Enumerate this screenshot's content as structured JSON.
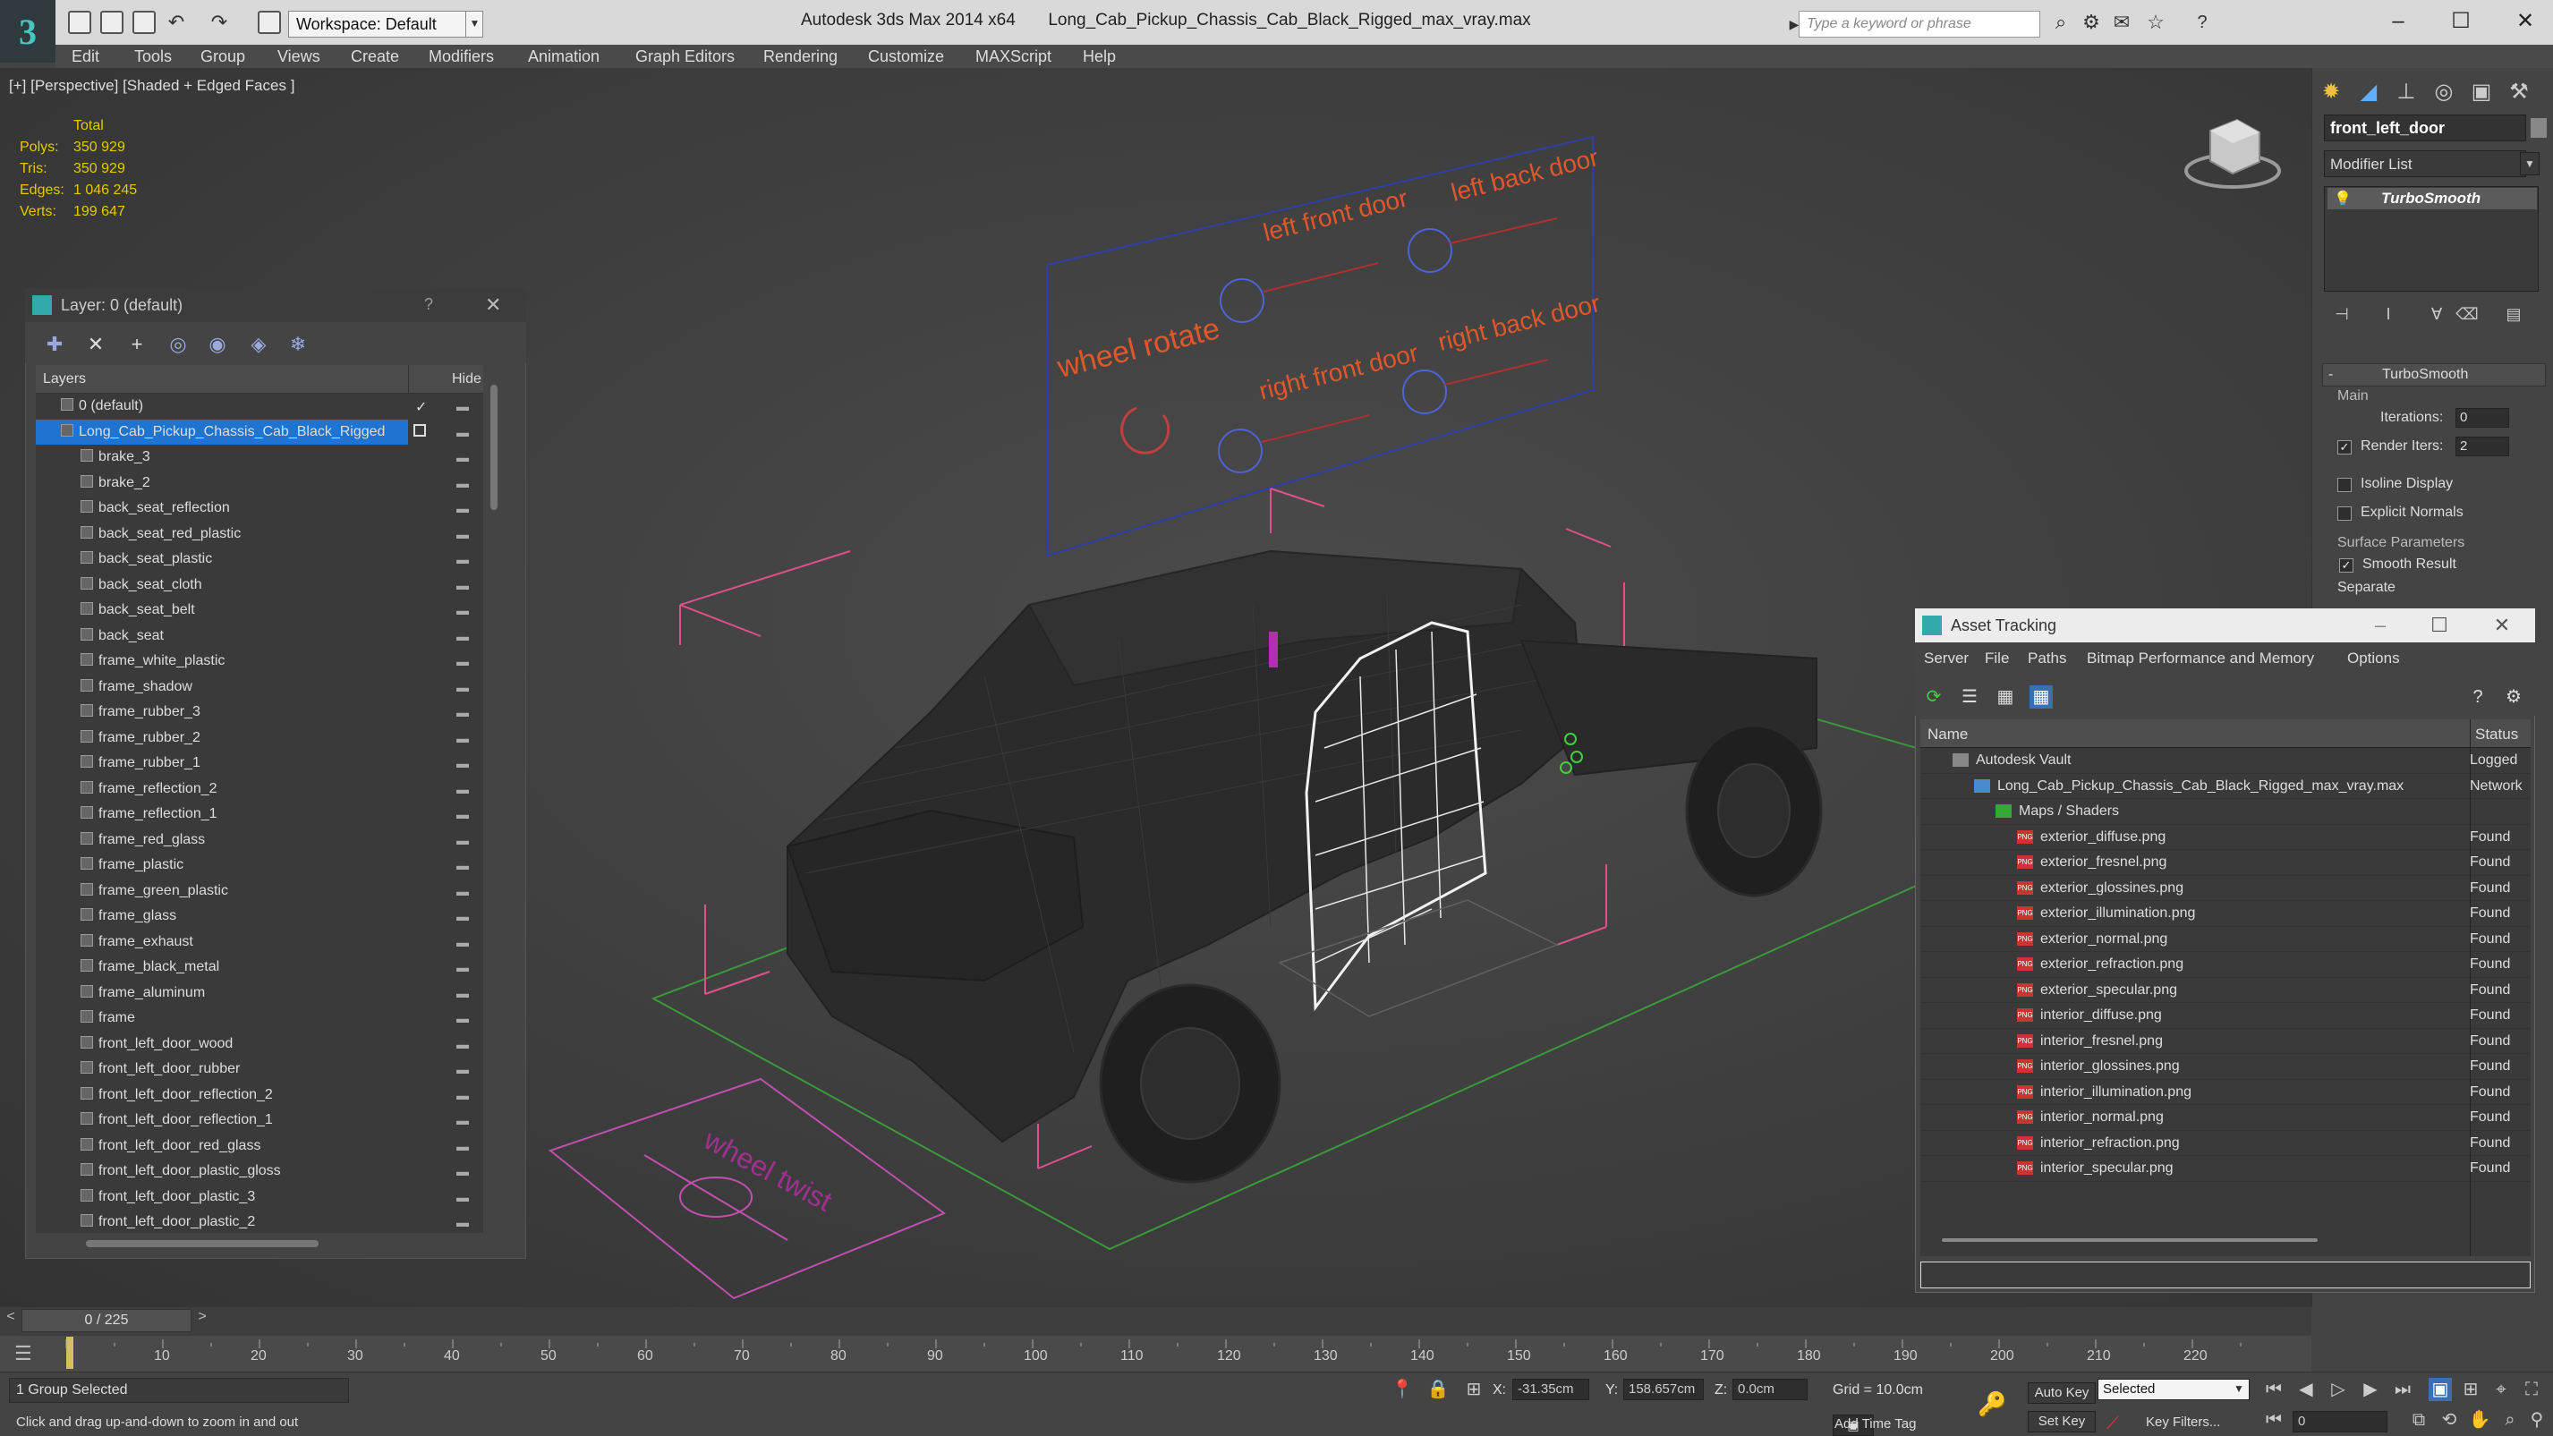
{
  "app": {
    "title": "Autodesk 3ds Max  2014 x64",
    "file": "Long_Cab_Pickup_Chassis_Cab_Black_Rigged_max_vray.max",
    "workspace": "Workspace: Default",
    "search_placeholder": "Type a keyword or phrase"
  },
  "menu": [
    "Edit",
    "Tools",
    "Group",
    "Views",
    "Create",
    "Modifiers",
    "Animation",
    "Graph Editors",
    "Rendering",
    "Customize",
    "MAXScript",
    "Help"
  ],
  "viewport": {
    "label": "[+] [Perspective] [Shaded + Edged Faces ]",
    "stats": {
      "total_label": "Total",
      "rows": [
        {
          "label": "Polys:",
          "value": "350 929"
        },
        {
          "label": "Tris:",
          "value": "350 929"
        },
        {
          "label": "Edges:",
          "value": "1 046 245"
        },
        {
          "label": "Verts:",
          "value": "199 647"
        }
      ]
    },
    "rig_labels": {
      "wheel_rotate": "wheel rotate",
      "left_front_door": "left front door",
      "left_back_door": "left back door",
      "right_front_door": "right front door",
      "right_back_door": "right back door",
      "wheel_twist": "wheel twist"
    }
  },
  "layer_dialog": {
    "title": "Layer: 0 (default)",
    "help": "?",
    "col_layers": "Layers",
    "col_hide": "Hide",
    "rows": [
      {
        "name": "0 (default)",
        "level": 0
      },
      {
        "name": "Long_Cab_Pickup_Chassis_Cab_Black_Rigged",
        "level": 0,
        "selected": true
      },
      {
        "name": "brake_3",
        "level": 1
      },
      {
        "name": "brake_2",
        "level": 1
      },
      {
        "name": "back_seat_reflection",
        "level": 1
      },
      {
        "name": "back_seat_red_plastic",
        "level": 1
      },
      {
        "name": "back_seat_plastic",
        "level": 1
      },
      {
        "name": "back_seat_cloth",
        "level": 1
      },
      {
        "name": "back_seat_belt",
        "level": 1
      },
      {
        "name": "back_seat",
        "level": 1
      },
      {
        "name": "frame_white_plastic",
        "level": 1
      },
      {
        "name": "frame_shadow",
        "level": 1
      },
      {
        "name": "frame_rubber_3",
        "level": 1
      },
      {
        "name": "frame_rubber_2",
        "level": 1
      },
      {
        "name": "frame_rubber_1",
        "level": 1
      },
      {
        "name": "frame_reflection_2",
        "level": 1
      },
      {
        "name": "frame_reflection_1",
        "level": 1
      },
      {
        "name": "frame_red_glass",
        "level": 1
      },
      {
        "name": "frame_plastic",
        "level": 1
      },
      {
        "name": "frame_green_plastic",
        "level": 1
      },
      {
        "name": "frame_glass",
        "level": 1
      },
      {
        "name": "frame_exhaust",
        "level": 1
      },
      {
        "name": "frame_black_metal",
        "level": 1
      },
      {
        "name": "frame_aluminum",
        "level": 1
      },
      {
        "name": "frame",
        "level": 1
      },
      {
        "name": "front_left_door_wood",
        "level": 1
      },
      {
        "name": "front_left_door_rubber",
        "level": 1
      },
      {
        "name": "front_left_door_reflection_2",
        "level": 1
      },
      {
        "name": "front_left_door_reflection_1",
        "level": 1
      },
      {
        "name": "front_left_door_red_glass",
        "level": 1
      },
      {
        "name": "front_left_door_plastic_gloss",
        "level": 1
      },
      {
        "name": "front_left_door_plastic_3",
        "level": 1
      },
      {
        "name": "front_left_door_plastic_2",
        "level": 1
      }
    ]
  },
  "command_panel": {
    "object_name": "front_left_door",
    "modifier_list": "Modifier List",
    "stack_item": "TurboSmooth",
    "rollout_title": "TurboSmooth",
    "main_label": "Main",
    "iterations_label": "Iterations:",
    "iterations_value": "0",
    "render_iters_label": "Render Iters:",
    "render_iters_value": "2",
    "isoline_label": "Isoline Display",
    "explicit_normals_label": "Explicit Normals",
    "surface_params_label": "Surface Parameters",
    "smooth_result_label": "Smooth Result",
    "separate_label": "Separate"
  },
  "asset_tracking": {
    "title": "Asset Tracking",
    "menu": [
      "Server",
      "File",
      "Paths",
      "Bitmap Performance and Memory",
      "Options"
    ],
    "col_name": "Name",
    "col_status": "Status",
    "rows": [
      {
        "name": "Autodesk Vault",
        "status": "Logged",
        "level": 0,
        "kind": "vault"
      },
      {
        "name": "Long_Cab_Pickup_Chassis_Cab_Black_Rigged_max_vray.max",
        "status": "Network",
        "level": 1,
        "kind": "max"
      },
      {
        "name": "Maps / Shaders",
        "status": "",
        "level": 2,
        "kind": "folder"
      },
      {
        "name": "exterior_diffuse.png",
        "status": "Found",
        "level": 3,
        "kind": "png"
      },
      {
        "name": "exterior_fresnel.png",
        "status": "Found",
        "level": 3,
        "kind": "png"
      },
      {
        "name": "exterior_glossines.png",
        "status": "Found",
        "level": 3,
        "kind": "png"
      },
      {
        "name": "exterior_illumination.png",
        "status": "Found",
        "level": 3,
        "kind": "png"
      },
      {
        "name": "exterior_normal.png",
        "status": "Found",
        "level": 3,
        "kind": "png"
      },
      {
        "name": "exterior_refraction.png",
        "status": "Found",
        "level": 3,
        "kind": "png"
      },
      {
        "name": "exterior_specular.png",
        "status": "Found",
        "level": 3,
        "kind": "png"
      },
      {
        "name": "interior_diffuse.png",
        "status": "Found",
        "level": 3,
        "kind": "png"
      },
      {
        "name": "interior_fresnel.png",
        "status": "Found",
        "level": 3,
        "kind": "png"
      },
      {
        "name": "interior_glossines.png",
        "status": "Found",
        "level": 3,
        "kind": "png"
      },
      {
        "name": "interior_illumination.png",
        "status": "Found",
        "level": 3,
        "kind": "png"
      },
      {
        "name": "interior_normal.png",
        "status": "Found",
        "level": 3,
        "kind": "png"
      },
      {
        "name": "interior_refraction.png",
        "status": "Found",
        "level": 3,
        "kind": "png"
      },
      {
        "name": "interior_specular.png",
        "status": "Found",
        "level": 3,
        "kind": "png"
      }
    ]
  },
  "timeline": {
    "frame_display": "0 / 225",
    "ticks": [
      "10",
      "20",
      "30",
      "40",
      "50",
      "60",
      "70",
      "80",
      "90",
      "100",
      "110",
      "120",
      "130",
      "140",
      "150",
      "160",
      "170",
      "180",
      "190",
      "200",
      "210",
      "220"
    ]
  },
  "status": {
    "selection": "1 Group Selected",
    "prompt": "Click and drag up-and-down to zoom in and out",
    "x_label": "X:",
    "x_value": "-31.35cm",
    "y_label": "Y:",
    "y_value": "158.657cm",
    "z_label": "Z:",
    "z_value": "0.0cm",
    "grid": "Grid = 10.0cm",
    "auto_key": "Auto Key",
    "set_key": "Set Key",
    "selected_dropdown": "Selected",
    "key_filters": "Key Filters...",
    "add_time_tag": "Add Time Tag",
    "frame_value": "0"
  },
  "colors": {
    "selection_blue": "#1e74d0",
    "stats_yellow": "#e6c700",
    "rig_orange": "#e0572a",
    "helper_pink": "#e0508a",
    "grid_green": "#3a9a3a"
  }
}
